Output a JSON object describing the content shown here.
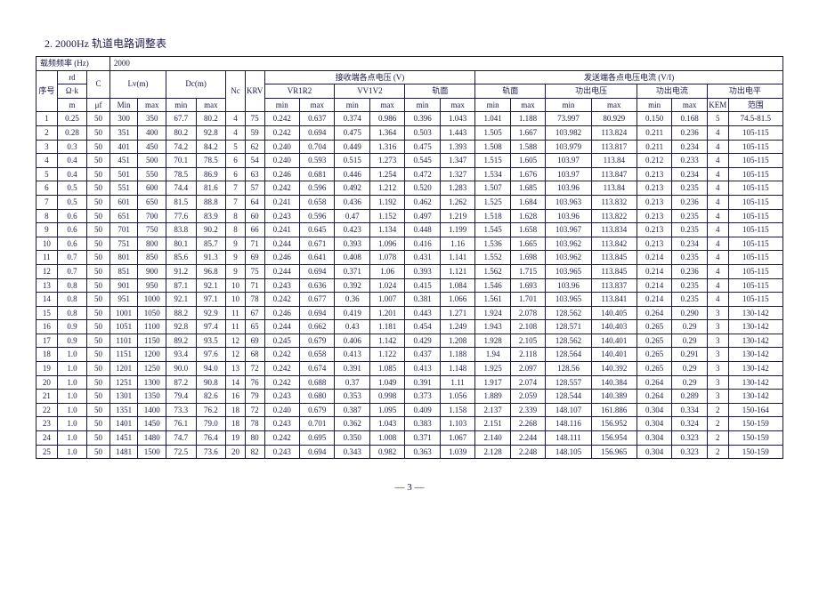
{
  "title": "2. 2000Hz 轨道电路调整表",
  "freq_label": "载频频率 (Hz)",
  "freq_value": "2000",
  "page_number": "— 3 —",
  "headers": {
    "seq": "序号",
    "rd_top": "rd",
    "rd_mid": "Ω·k",
    "rd_bot": "m",
    "c_top": "C",
    "c_bot": "μf",
    "lv": "Lv(m)",
    "dc": "Dc(m)",
    "nc": "Nc",
    "krv": "KRV",
    "recv_group": "接收端各点电压 (V)",
    "vr1r2": "VR1R2",
    "vv1v2": "VV1V2",
    "rail_recv": "轨面",
    "send_group": "发送端各点电压电流 (V/I)",
    "rail_send": "轨面",
    "out_voltage": "功出电压",
    "out_current": "功出电流",
    "out_level": "功出电平",
    "min": "min",
    "max": "max",
    "Min": "Min",
    "kem": "KEM",
    "range": "范围"
  },
  "rows": [
    {
      "seq": "1",
      "rd": "0.25",
      "c": "50",
      "lv_min": "300",
      "lv_max": "350",
      "dc_min": "67.7",
      "dc_max": "80.2",
      "nc": "4",
      "krv": "75",
      "vr_min": "0.242",
      "vr_max": "0.637",
      "vv_min": "0.374",
      "vv_max": "0.986",
      "rr_min": "0.396",
      "rr_max": "1.043",
      "rs_min": "1.041",
      "rs_max": "1.188",
      "ov_min": "73.997",
      "ov_max": "80.929",
      "oc_min": "0.150",
      "oc_max": "0.168",
      "kem": "5",
      "rng": "74.5-81.5"
    },
    {
      "seq": "2",
      "rd": "0.28",
      "c": "50",
      "lv_min": "351",
      "lv_max": "400",
      "dc_min": "80.2",
      "dc_max": "92.8",
      "nc": "4",
      "krv": "59",
      "vr_min": "0.242",
      "vr_max": "0.694",
      "vv_min": "0.475",
      "vv_max": "1.364",
      "rr_min": "0.503",
      "rr_max": "1.443",
      "rs_min": "1.505",
      "rs_max": "1.667",
      "ov_min": "103.982",
      "ov_max": "113.824",
      "oc_min": "0.211",
      "oc_max": "0.236",
      "kem": "4",
      "rng": "105-115"
    },
    {
      "seq": "3",
      "rd": "0.3",
      "c": "50",
      "lv_min": "401",
      "lv_max": "450",
      "dc_min": "74.2",
      "dc_max": "84.2",
      "nc": "5",
      "krv": "62",
      "vr_min": "0.240",
      "vr_max": "0.704",
      "vv_min": "0.449",
      "vv_max": "1.316",
      "rr_min": "0.475",
      "rr_max": "1.393",
      "rs_min": "1.508",
      "rs_max": "1.588",
      "ov_min": "103.979",
      "ov_max": "113.817",
      "oc_min": "0.211",
      "oc_max": "0.234",
      "kem": "4",
      "rng": "105-115"
    },
    {
      "seq": "4",
      "rd": "0.4",
      "c": "50",
      "lv_min": "451",
      "lv_max": "500",
      "dc_min": "70.1",
      "dc_max": "78.5",
      "nc": "6",
      "krv": "54",
      "vr_min": "0.240",
      "vr_max": "0.593",
      "vv_min": "0.515",
      "vv_max": "1.273",
      "rr_min": "0.545",
      "rr_max": "1.347",
      "rs_min": "1.515",
      "rs_max": "1.605",
      "ov_min": "103.97",
      "ov_max": "113.84",
      "oc_min": "0.212",
      "oc_max": "0.233",
      "kem": "4",
      "rng": "105-115"
    },
    {
      "seq": "5",
      "rd": "0.4",
      "c": "50",
      "lv_min": "501",
      "lv_max": "550",
      "dc_min": "78.5",
      "dc_max": "86.9",
      "nc": "6",
      "krv": "63",
      "vr_min": "0.246",
      "vr_max": "0.681",
      "vv_min": "0.446",
      "vv_max": "1.254",
      "rr_min": "0.472",
      "rr_max": "1.327",
      "rs_min": "1.534",
      "rs_max": "1.676",
      "ov_min": "103.97",
      "ov_max": "113.847",
      "oc_min": "0.213",
      "oc_max": "0.234",
      "kem": "4",
      "rng": "105-115"
    },
    {
      "seq": "6",
      "rd": "0.5",
      "c": "50",
      "lv_min": "551",
      "lv_max": "600",
      "dc_min": "74.4",
      "dc_max": "81.6",
      "nc": "7",
      "krv": "57",
      "vr_min": "0.242",
      "vr_max": "0.596",
      "vv_min": "0.492",
      "vv_max": "1.212",
      "rr_min": "0.520",
      "rr_max": "1.283",
      "rs_min": "1.507",
      "rs_max": "1.685",
      "ov_min": "103.96",
      "ov_max": "113.84",
      "oc_min": "0.213",
      "oc_max": "0.235",
      "kem": "4",
      "rng": "105-115"
    },
    {
      "seq": "7",
      "rd": "0.5",
      "c": "50",
      "lv_min": "601",
      "lv_max": "650",
      "dc_min": "81.5",
      "dc_max": "88.8",
      "nc": "7",
      "krv": "64",
      "vr_min": "0.241",
      "vr_max": "0.658",
      "vv_min": "0.436",
      "vv_max": "1.192",
      "rr_min": "0.462",
      "rr_max": "1.262",
      "rs_min": "1.525",
      "rs_max": "1.684",
      "ov_min": "103.963",
      "ov_max": "113.832",
      "oc_min": "0.213",
      "oc_max": "0.236",
      "kem": "4",
      "rng": "105-115"
    },
    {
      "seq": "8",
      "rd": "0.6",
      "c": "50",
      "lv_min": "651",
      "lv_max": "700",
      "dc_min": "77.6",
      "dc_max": "83.9",
      "nc": "8",
      "krv": "60",
      "vr_min": "0.243",
      "vr_max": "0.596",
      "vv_min": "0.47",
      "vv_max": "1.152",
      "rr_min": "0.497",
      "rr_max": "1.219",
      "rs_min": "1.518",
      "rs_max": "1.628",
      "ov_min": "103.96",
      "ov_max": "113.822",
      "oc_min": "0.213",
      "oc_max": "0.235",
      "kem": "4",
      "rng": "105-115"
    },
    {
      "seq": "9",
      "rd": "0.6",
      "c": "50",
      "lv_min": "701",
      "lv_max": "750",
      "dc_min": "83.8",
      "dc_max": "90.2",
      "nc": "8",
      "krv": "66",
      "vr_min": "0.241",
      "vr_max": "0.645",
      "vv_min": "0.423",
      "vv_max": "1.134",
      "rr_min": "0.448",
      "rr_max": "1.199",
      "rs_min": "1.545",
      "rs_max": "1.658",
      "ov_min": "103.967",
      "ov_max": "113.834",
      "oc_min": "0.213",
      "oc_max": "0.235",
      "kem": "4",
      "rng": "105-115"
    },
    {
      "seq": "10",
      "rd": "0.6",
      "c": "50",
      "lv_min": "751",
      "lv_max": "800",
      "dc_min": "80.1",
      "dc_max": "85.7",
      "nc": "9",
      "krv": "71",
      "vr_min": "0.244",
      "vr_max": "0.671",
      "vv_min": "0.393",
      "vv_max": "1.096",
      "rr_min": "0.416",
      "rr_max": "1.16",
      "rs_min": "1.536",
      "rs_max": "1.665",
      "ov_min": "103.962",
      "ov_max": "113.842",
      "oc_min": "0.213",
      "oc_max": "0.234",
      "kem": "4",
      "rng": "105-115"
    },
    {
      "seq": "11",
      "rd": "0.7",
      "c": "50",
      "lv_min": "801",
      "lv_max": "850",
      "dc_min": "85.6",
      "dc_max": "91.3",
      "nc": "9",
      "krv": "69",
      "vr_min": "0.246",
      "vr_max": "0.641",
      "vv_min": "0.408",
      "vv_max": "1.078",
      "rr_min": "0.431",
      "rr_max": "1.141",
      "rs_min": "1.552",
      "rs_max": "1.698",
      "ov_min": "103.962",
      "ov_max": "113.845",
      "oc_min": "0.214",
      "oc_max": "0.235",
      "kem": "4",
      "rng": "105-115"
    },
    {
      "seq": "12",
      "rd": "0.7",
      "c": "50",
      "lv_min": "851",
      "lv_max": "900",
      "dc_min": "91.2",
      "dc_max": "96.8",
      "nc": "9",
      "krv": "75",
      "vr_min": "0.244",
      "vr_max": "0.694",
      "vv_min": "0.371",
      "vv_max": "1.06",
      "rr_min": "0.393",
      "rr_max": "1.121",
      "rs_min": "1.562",
      "rs_max": "1.715",
      "ov_min": "103.965",
      "ov_max": "113.845",
      "oc_min": "0.214",
      "oc_max": "0.236",
      "kem": "4",
      "rng": "105-115"
    },
    {
      "seq": "13",
      "rd": "0.8",
      "c": "50",
      "lv_min": "901",
      "lv_max": "950",
      "dc_min": "87.1",
      "dc_max": "92.1",
      "nc": "10",
      "krv": "71",
      "vr_min": "0.243",
      "vr_max": "0.636",
      "vv_min": "0.392",
      "vv_max": "1.024",
      "rr_min": "0.415",
      "rr_max": "1.084",
      "rs_min": "1.546",
      "rs_max": "1.693",
      "ov_min": "103.96",
      "ov_max": "113.837",
      "oc_min": "0.214",
      "oc_max": "0.235",
      "kem": "4",
      "rng": "105-115"
    },
    {
      "seq": "14",
      "rd": "0.8",
      "c": "50",
      "lv_min": "951",
      "lv_max": "1000",
      "dc_min": "92.1",
      "dc_max": "97.1",
      "nc": "10",
      "krv": "78",
      "vr_min": "0.242",
      "vr_max": "0.677",
      "vv_min": "0.36",
      "vv_max": "1.007",
      "rr_min": "0.381",
      "rr_max": "1.066",
      "rs_min": "1.561",
      "rs_max": "1.701",
      "ov_min": "103.965",
      "ov_max": "113.841",
      "oc_min": "0.214",
      "oc_max": "0.235",
      "kem": "4",
      "rng": "105-115"
    },
    {
      "seq": "15",
      "rd": "0.8",
      "c": "50",
      "lv_min": "1001",
      "lv_max": "1050",
      "dc_min": "88.2",
      "dc_max": "92.9",
      "nc": "11",
      "krv": "67",
      "vr_min": "0.246",
      "vr_max": "0.694",
      "vv_min": "0.419",
      "vv_max": "1.201",
      "rr_min": "0.443",
      "rr_max": "1.271",
      "rs_min": "1.924",
      "rs_max": "2.078",
      "ov_min": "128.562",
      "ov_max": "140.405",
      "oc_min": "0.264",
      "oc_max": "0.290",
      "kem": "3",
      "rng": "130-142"
    },
    {
      "seq": "16",
      "rd": "0.9",
      "c": "50",
      "lv_min": "1051",
      "lv_max": "1100",
      "dc_min": "92.8",
      "dc_max": "97.4",
      "nc": "11",
      "krv": "65",
      "vr_min": "0.244",
      "vr_max": "0.662",
      "vv_min": "0.43",
      "vv_max": "1.181",
      "rr_min": "0.454",
      "rr_max": "1.249",
      "rs_min": "1.943",
      "rs_max": "2.108",
      "ov_min": "128.571",
      "ov_max": "140.403",
      "oc_min": "0.265",
      "oc_max": "0.29",
      "kem": "3",
      "rng": "130-142"
    },
    {
      "seq": "17",
      "rd": "0.9",
      "c": "50",
      "lv_min": "1101",
      "lv_max": "1150",
      "dc_min": "89.2",
      "dc_max": "93.5",
      "nc": "12",
      "krv": "69",
      "vr_min": "0.245",
      "vr_max": "0.679",
      "vv_min": "0.406",
      "vv_max": "1.142",
      "rr_min": "0.429",
      "rr_max": "1.208",
      "rs_min": "1.928",
      "rs_max": "2.105",
      "ov_min": "128.562",
      "ov_max": "140.401",
      "oc_min": "0.265",
      "oc_max": "0.29",
      "kem": "3",
      "rng": "130-142"
    },
    {
      "seq": "18",
      "rd": "1.0",
      "c": "50",
      "lv_min": "1151",
      "lv_max": "1200",
      "dc_min": "93.4",
      "dc_max": "97.6",
      "nc": "12",
      "krv": "68",
      "vr_min": "0.242",
      "vr_max": "0.658",
      "vv_min": "0.413",
      "vv_max": "1.122",
      "rr_min": "0.437",
      "rr_max": "1.188",
      "rs_min": "1.94",
      "rs_max": "2.118",
      "ov_min": "128.564",
      "ov_max": "140.401",
      "oc_min": "0.265",
      "oc_max": "0.291",
      "kem": "3",
      "rng": "130-142"
    },
    {
      "seq": "19",
      "rd": "1.0",
      "c": "50",
      "lv_min": "1201",
      "lv_max": "1250",
      "dc_min": "90.0",
      "dc_max": "94.0",
      "nc": "13",
      "krv": "72",
      "vr_min": "0.242",
      "vr_max": "0.674",
      "vv_min": "0.391",
      "vv_max": "1.085",
      "rr_min": "0.413",
      "rr_max": "1.148",
      "rs_min": "1.925",
      "rs_max": "2.097",
      "ov_min": "128.56",
      "ov_max": "140.392",
      "oc_min": "0.265",
      "oc_max": "0.29",
      "kem": "3",
      "rng": "130-142"
    },
    {
      "seq": "20",
      "rd": "1.0",
      "c": "50",
      "lv_min": "1251",
      "lv_max": "1300",
      "dc_min": "87.2",
      "dc_max": "90.8",
      "nc": "14",
      "krv": "76",
      "vr_min": "0.242",
      "vr_max": "0.688",
      "vv_min": "0.37",
      "vv_max": "1.049",
      "rr_min": "0.391",
      "rr_max": "1.11",
      "rs_min": "1.917",
      "rs_max": "2.074",
      "ov_min": "128.557",
      "ov_max": "140.384",
      "oc_min": "0.264",
      "oc_max": "0.29",
      "kem": "3",
      "rng": "130-142"
    },
    {
      "seq": "21",
      "rd": "1.0",
      "c": "50",
      "lv_min": "1301",
      "lv_max": "1350",
      "dc_min": "79.4",
      "dc_max": "82.6",
      "nc": "16",
      "krv": "79",
      "vr_min": "0.243",
      "vr_max": "0.680",
      "vv_min": "0.353",
      "vv_max": "0.998",
      "rr_min": "0.373",
      "rr_max": "1.056",
      "rs_min": "1.889",
      "rs_max": "2.059",
      "ov_min": "128.544",
      "ov_max": "140.389",
      "oc_min": "0.264",
      "oc_max": "0.289",
      "kem": "3",
      "rng": "130-142"
    },
    {
      "seq": "22",
      "rd": "1.0",
      "c": "50",
      "lv_min": "1351",
      "lv_max": "1400",
      "dc_min": "73.3",
      "dc_max": "76.2",
      "nc": "18",
      "krv": "72",
      "vr_min": "0.240",
      "vr_max": "0.679",
      "vv_min": "0.387",
      "vv_max": "1.095",
      "rr_min": "0.409",
      "rr_max": "1.158",
      "rs_min": "2.137",
      "rs_max": "2.339",
      "ov_min": "148.107",
      "ov_max": "161.886",
      "oc_min": "0.304",
      "oc_max": "0.334",
      "kem": "2",
      "rng": "150-164"
    },
    {
      "seq": "23",
      "rd": "1.0",
      "c": "50",
      "lv_min": "1401",
      "lv_max": "1450",
      "dc_min": "76.1",
      "dc_max": "79.0",
      "nc": "18",
      "krv": "78",
      "vr_min": "0.243",
      "vr_max": "0.701",
      "vv_min": "0.362",
      "vv_max": "1.043",
      "rr_min": "0.383",
      "rr_max": "1.103",
      "rs_min": "2.151",
      "rs_max": "2.268",
      "ov_min": "148.116",
      "ov_max": "156.952",
      "oc_min": "0.304",
      "oc_max": "0.324",
      "kem": "2",
      "rng": "150-159"
    },
    {
      "seq": "24",
      "rd": "1.0",
      "c": "50",
      "lv_min": "1451",
      "lv_max": "1480",
      "dc_min": "74.7",
      "dc_max": "76.4",
      "nc": "19",
      "krv": "80",
      "vr_min": "0.242",
      "vr_max": "0.695",
      "vv_min": "0.350",
      "vv_max": "1.008",
      "rr_min": "0.371",
      "rr_max": "1.067",
      "rs_min": "2.140",
      "rs_max": "2.244",
      "ov_min": "148.111",
      "ov_max": "156.954",
      "oc_min": "0.304",
      "oc_max": "0.323",
      "kem": "2",
      "rng": "150-159"
    },
    {
      "seq": "25",
      "rd": "1.0",
      "c": "50",
      "lv_min": "1481",
      "lv_max": "1500",
      "dc_min": "72.5",
      "dc_max": "73.6",
      "nc": "20",
      "krv": "82",
      "vr_min": "0.243",
      "vr_max": "0.694",
      "vv_min": "0.343",
      "vv_max": "0.982",
      "rr_min": "0.363",
      "rr_max": "1.039",
      "rs_min": "2.128",
      "rs_max": "2.248",
      "ov_min": "148.105",
      "ov_max": "156.965",
      "oc_min": "0.304",
      "oc_max": "0.323",
      "kem": "2",
      "rng": "150-159"
    }
  ]
}
